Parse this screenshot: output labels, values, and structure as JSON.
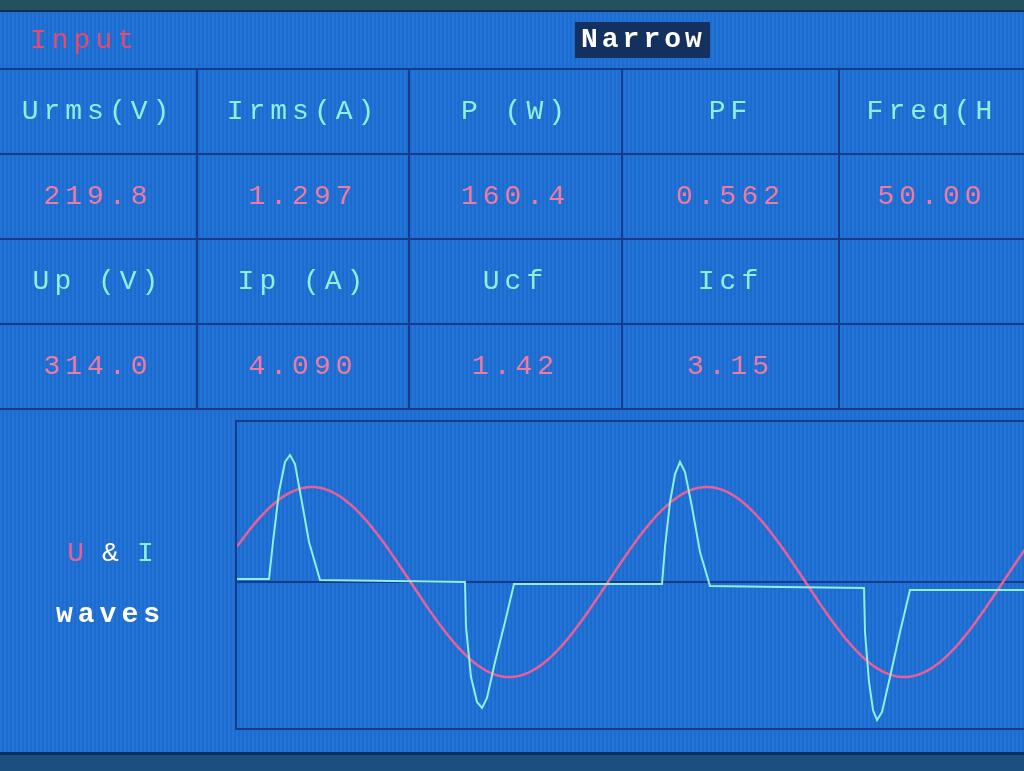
{
  "screen": {
    "title": "Input",
    "range_tag": "Narrow",
    "table": {
      "rows": [
        {
          "kind": "header",
          "cells": [
            "Urms(V)",
            "Irms(A)",
            "P (W)",
            "PF",
            "Freq(H"
          ]
        },
        {
          "kind": "value",
          "cells": [
            "219.8",
            "1.297",
            "160.4",
            "0.562",
            "50.00"
          ]
        },
        {
          "kind": "header",
          "cells": [
            "Up (V)",
            "Ip (A)",
            "Ucf",
            "Icf"
          ]
        },
        {
          "kind": "value",
          "cells": [
            "314.0",
            "4.090",
            "1.42",
            "3.15"
          ]
        }
      ]
    },
    "waves": {
      "legend": [
        {
          "text": "U",
          "color": "#e8609a"
        },
        {
          "text": "&",
          "color": "#ffffff"
        },
        {
          "text": "I",
          "color": "#8ef0dc"
        }
      ],
      "caption": "waves"
    }
  }
}
